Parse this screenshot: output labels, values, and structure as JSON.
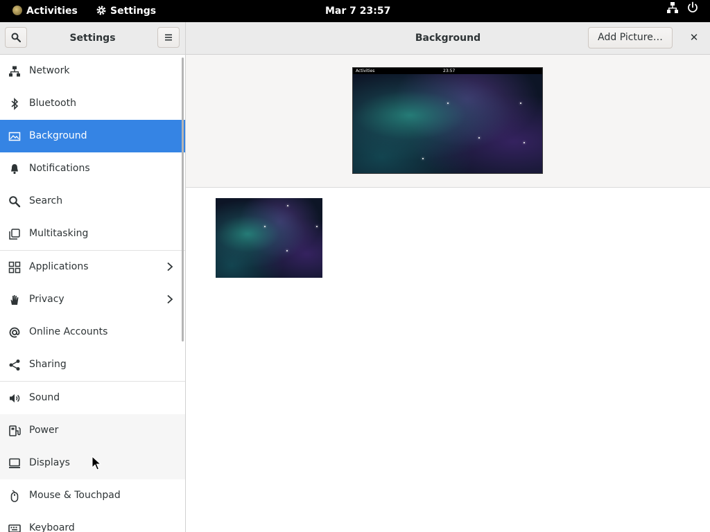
{
  "topbar": {
    "activities": "Activities",
    "app_menu": "Settings",
    "clock": "Mar 7  23:57"
  },
  "sidebar": {
    "title": "Settings",
    "items": [
      {
        "label": "Network",
        "icon": "network-icon"
      },
      {
        "label": "Bluetooth",
        "icon": "bluetooth-icon"
      },
      {
        "label": "Background",
        "icon": "background-icon",
        "selected": true
      },
      {
        "label": "Notifications",
        "icon": "bell-icon"
      },
      {
        "label": "Search",
        "icon": "search-icon"
      },
      {
        "label": "Multitasking",
        "icon": "multitasking-icon"
      },
      {
        "label": "Applications",
        "icon": "applications-icon",
        "has_submenu": true
      },
      {
        "label": "Privacy",
        "icon": "hand-icon",
        "has_submenu": true
      },
      {
        "label": "Online Accounts",
        "icon": "at-icon"
      },
      {
        "label": "Sharing",
        "icon": "share-icon"
      },
      {
        "label": "Sound",
        "icon": "speaker-icon"
      },
      {
        "label": "Power",
        "icon": "power-icon"
      },
      {
        "label": "Displays",
        "icon": "display-icon"
      },
      {
        "label": "Mouse & Touchpad",
        "icon": "mouse-icon"
      },
      {
        "label": "Keyboard",
        "icon": "keyboard-icon"
      }
    ]
  },
  "header": {
    "title": "Background",
    "add_picture": "Add Picture…"
  },
  "preview": {
    "activities": "Activities",
    "clock": "23:57"
  },
  "colors": {
    "accent": "#3584e4",
    "topbar": "#000000"
  }
}
